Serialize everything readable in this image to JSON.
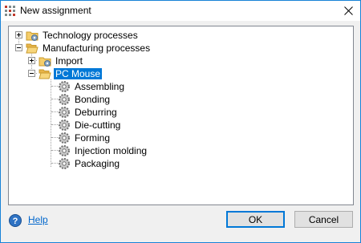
{
  "window": {
    "title": "New assignment",
    "app_icon": "grid-icon",
    "close_icon": "close-icon"
  },
  "tree": {
    "nodes": [
      {
        "label": "Technology processes",
        "icon": "folder-gear-icon",
        "expander": "plus"
      },
      {
        "label": "Manufacturing processes",
        "icon": "open-folder-icon",
        "expander": "minus"
      },
      {
        "label": "Import",
        "icon": "folder-gear-icon",
        "expander": "plus"
      },
      {
        "label": "PC Mouse",
        "icon": "open-folder-icon",
        "expander": "minus",
        "selected": true
      },
      {
        "label": "Assembling",
        "icon": "gear-icon"
      },
      {
        "label": "Bonding",
        "icon": "gear-icon"
      },
      {
        "label": "Deburring",
        "icon": "gear-icon"
      },
      {
        "label": "Die-cutting",
        "icon": "gear-icon"
      },
      {
        "label": "Forming",
        "icon": "gear-icon"
      },
      {
        "label": "Injection molding",
        "icon": "gear-icon"
      },
      {
        "label": "Packaging",
        "icon": "gear-icon"
      }
    ]
  },
  "footer": {
    "help_label": "Help",
    "help_icon": "help-icon",
    "ok_label": "OK",
    "cancel_label": "Cancel"
  },
  "colors": {
    "selection": "#0078d7",
    "link": "#0066cc",
    "window_border": "#1883d7"
  }
}
